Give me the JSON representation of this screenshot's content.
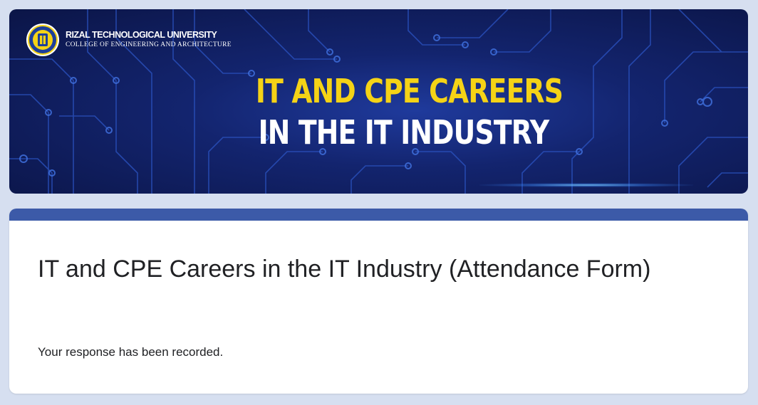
{
  "banner": {
    "university_name": "RIZAL TECHNOLOGICAL UNIVERSITY",
    "college_name": "COLLEGE OF ENGINEERING AND ARCHITECTURE",
    "headline_line1": "IT AND CPE CAREERS",
    "headline_line2": "IN THE IT INDUSTRY",
    "seal_icon": "university-seal-icon"
  },
  "form": {
    "title": "IT and CPE Careers in the IT Industry (Attendance Form)",
    "confirmation": "Your response has been recorded."
  },
  "colors": {
    "page_background": "#d6dff0",
    "banner_background": "#13246e",
    "headline_yellow": "#f5d316",
    "card_accent": "#3c5aa8",
    "text": "#202124"
  }
}
